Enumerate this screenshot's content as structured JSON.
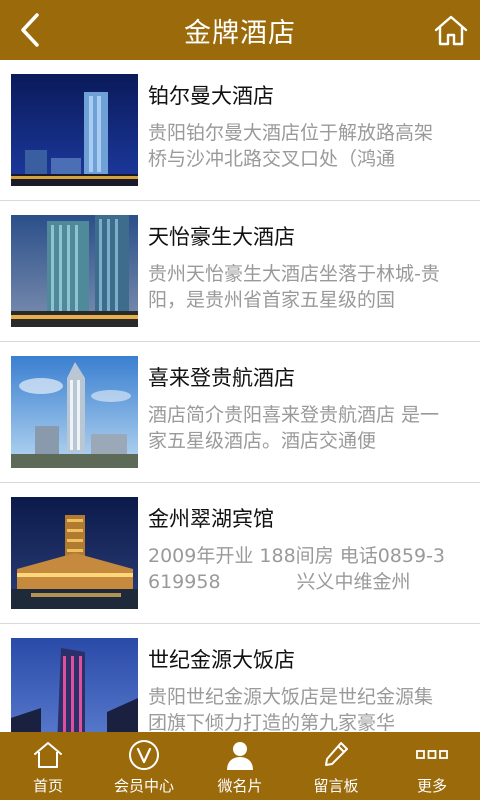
{
  "header": {
    "title": "金牌酒店",
    "back_icon": "chevron-left-icon",
    "home_icon": "home-icon"
  },
  "colors": {
    "brand": "#9b6a0a",
    "title_text": "#111111",
    "desc_text": "#9a9a9a"
  },
  "hotels": [
    {
      "name": "铂尔曼大酒店",
      "desc": "贵阳铂尔曼大酒店位于解放路高架桥与沙冲北路交叉口处（鸿通"
    },
    {
      "name": "天怡豪生大酒店",
      "desc": "贵州天怡豪生大酒店坐落于林城-贵阳，是贵州省首家五星级的国"
    },
    {
      "name": "喜来登贵航酒店",
      "desc": "酒店简介贵阳喜来登贵航酒店 是一家五星级酒店。酒店交通便"
    },
    {
      "name": "金州翠湖宾馆",
      "desc": "2009年开业 188间房 电话0859-3619958　　　　兴义中维金州"
    },
    {
      "name": "世纪金源大饭店",
      "desc": "贵阳世纪金源大饭店是世纪金源集团旗下倾力打造的第九家豪华"
    }
  ],
  "tabbar": [
    {
      "label": "首页",
      "icon": "home-icon"
    },
    {
      "label": "会员中心",
      "icon": "vip-icon"
    },
    {
      "label": "微名片",
      "icon": "person-icon"
    },
    {
      "label": "留言板",
      "icon": "pen-icon"
    },
    {
      "label": "更多",
      "icon": "more-icon"
    }
  ]
}
